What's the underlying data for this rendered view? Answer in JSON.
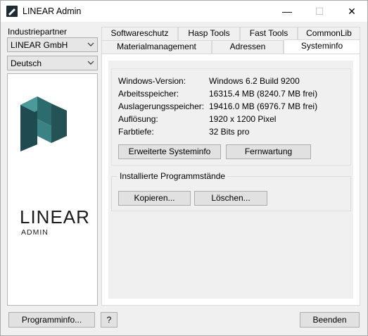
{
  "window": {
    "title": "LINEAR Admin",
    "minimize": "—",
    "maximize": "☐",
    "close": "✕"
  },
  "sidebar": {
    "partner_label": "Industriepartner",
    "partner_value": "LINEAR GmbH",
    "language_value": "Deutsch",
    "logo_word": "LINEAR",
    "logo_sub": "ADMIN"
  },
  "tabs_row1": [
    "Softwareschutz",
    "Hasp Tools",
    "Fast Tools",
    "CommonLib"
  ],
  "tabs_row2": [
    "Materialmanagement",
    "Adressen",
    "Systeminfo"
  ],
  "sysinfo": {
    "rows": [
      {
        "label": "Windows-Version:",
        "value": "Windows 6.2 Build 9200"
      },
      {
        "label": "Arbeitsspeicher:",
        "value": "16315.4 MB (8240.7 MB frei)"
      },
      {
        "label": "Auslagerungsspeicher:",
        "value": "19416.0 MB (6976.7 MB frei)"
      },
      {
        "label": "Auflösung:",
        "value": "1920 x 1200 Pixel"
      },
      {
        "label": "Farbtiefe:",
        "value": "32 Bits pro"
      }
    ],
    "btn_extended": "Erweiterte Systeminfo",
    "btn_remote": "Fernwartung"
  },
  "programs": {
    "group_title": "Installierte Programmstände",
    "btn_copy": "Kopieren...",
    "btn_delete": "Löschen..."
  },
  "footer": {
    "btn_programinfo": "Programminfo...",
    "btn_help": "?",
    "btn_exit": "Beenden"
  },
  "colors": {
    "logo_dark": "#1f4a4f",
    "logo_light": "#3f8a8a"
  }
}
